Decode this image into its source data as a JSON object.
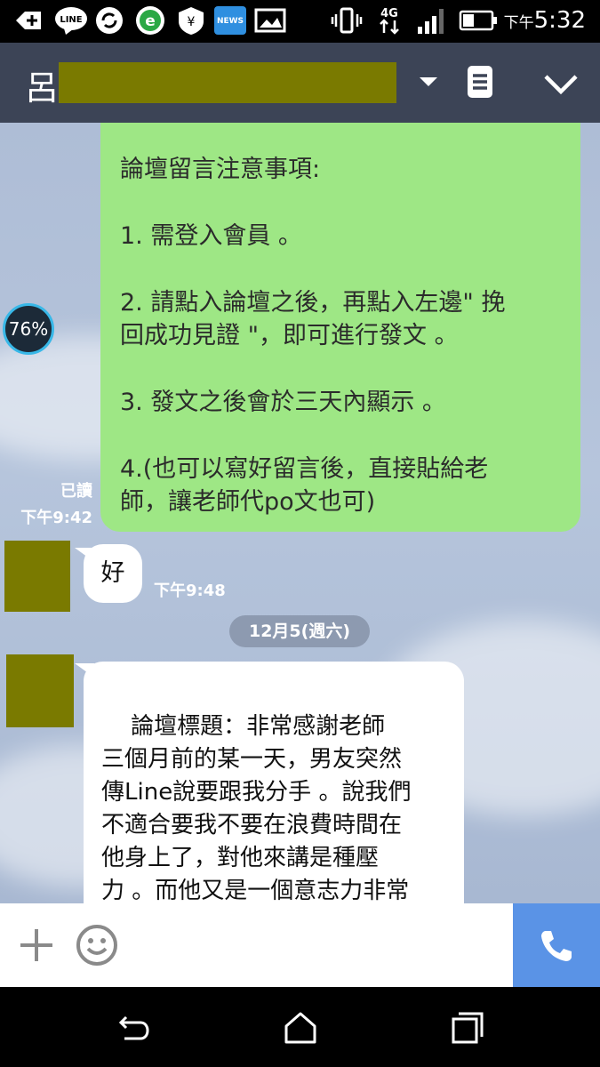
{
  "status_bar": {
    "signal": "4G",
    "time_prefix": "下午",
    "time": "5:32"
  },
  "header": {
    "contact_initial": "呂"
  },
  "battery_badge": "76%",
  "messages": {
    "sent": {
      "lines": [
        "論壇留言注意事項:",
        "1. 需登入會員 。",
        "2. 請點入論壇之後，再點入左邊\" 挽\n回成功見證 \"，即可進行發文 。",
        "3. 發文之後會於三天內顯示 。",
        "4.(也可以寫好留言後，直接貼給老\n師，讓老師代po文也可)"
      ],
      "read_label": "已讀",
      "time": "下午9:42"
    },
    "reply1": {
      "text": "好",
      "time": "下午9:48"
    },
    "date_separator": "12月5(週六)",
    "reply2": {
      "text": "論壇標題：非常感謝老師\n三個月前的某一天，男友突然\n傳Line說要跟我分手 。說我們\n不適合要我不要在浪費時間在\n他身上了，對他來講是種壓\n力 。而他又是一個意志力非常\n堅定的人，一但決定了就很難"
    }
  },
  "icons": {
    "add": "plus-icon",
    "emoji": "smiley-icon",
    "call": "phone-icon",
    "back": "back-icon",
    "home": "home-icon",
    "recents": "recents-icon"
  },
  "colors": {
    "sent_bubble": "#9ee785",
    "header_bg": "#3c4456",
    "call_button": "#5a93e6",
    "redaction": "#7a7a00"
  }
}
